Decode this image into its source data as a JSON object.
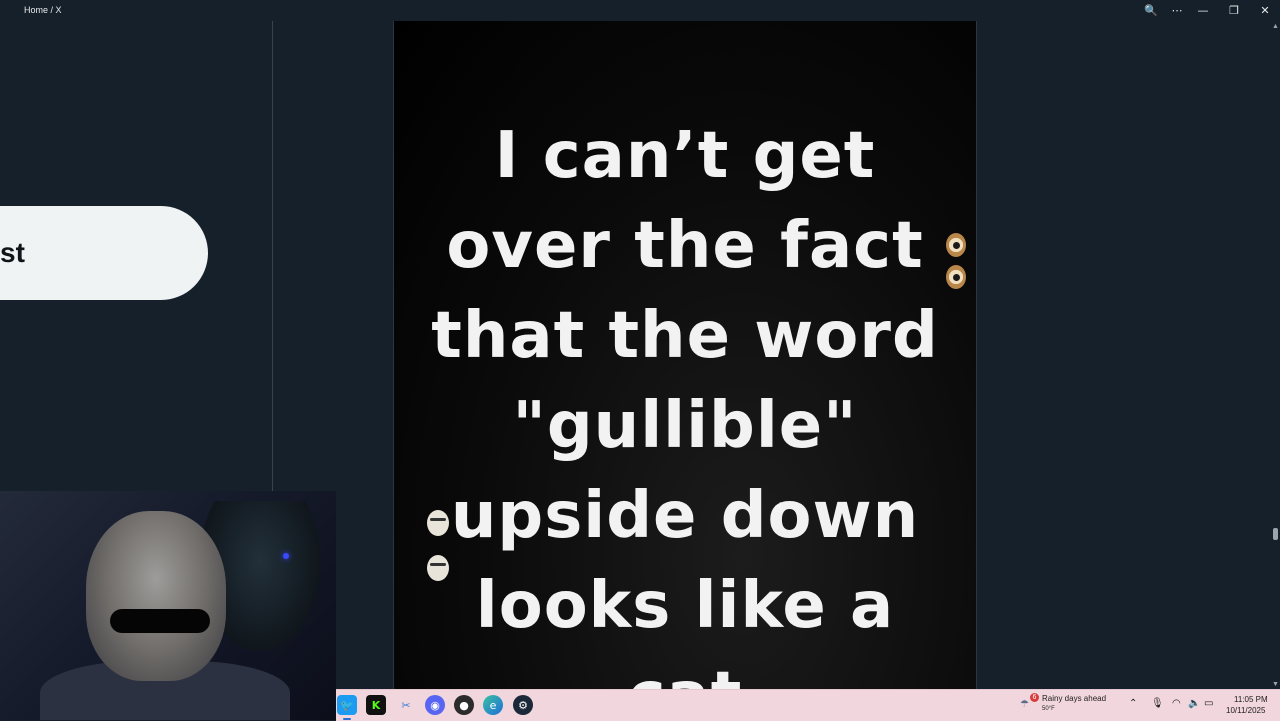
{
  "window": {
    "title": "Home / X",
    "controls": {
      "zoom": "🔍",
      "more": "⋯",
      "minimize": "—",
      "restore": "❐",
      "close": "✕"
    }
  },
  "sidebar": {
    "post_button_label": "st"
  },
  "media": {
    "lines": [
      "I can’t get",
      "over the fact",
      "that the word",
      "\"gullible\"",
      "upside down",
      "looks like a",
      "cat"
    ]
  },
  "taskbar": {
    "apps": [
      "twitter",
      "kick",
      "snipping-tool",
      "discord",
      "obs",
      "edge",
      "steam"
    ],
    "weather": {
      "text": "Rainy days ahead",
      "temp": "50°F",
      "badge": "6"
    },
    "clock": {
      "time": "11:05 PM",
      "date": "10/11/2025"
    }
  },
  "colors": {
    "background": "#15202b",
    "post_button": "#eff3f4",
    "taskbar": "#f2d6de"
  }
}
